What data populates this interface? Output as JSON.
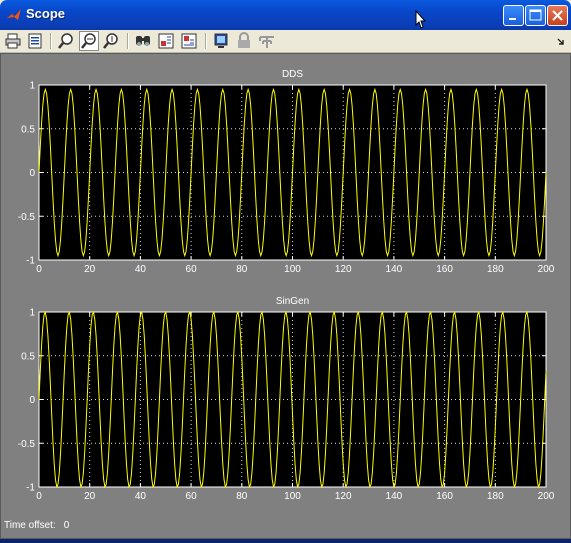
{
  "window": {
    "title": "Scope"
  },
  "toolbar": {
    "items": [
      "print-icon",
      "parameters-icon",
      "zoom-icon",
      "zoom-x-icon",
      "zoom-y-icon",
      "autoscale-icon",
      "save-axes-icon",
      "restore-axes-icon",
      "floating-scope-icon",
      "lock-icon",
      "signal-selection-icon"
    ],
    "active": "zoom-x-icon"
  },
  "status": {
    "label": "Time offset:",
    "value": "0"
  },
  "colors": {
    "trace": "#ffff00",
    "axes_bg": "#000000",
    "figure_bg": "#808080",
    "grid": "#ffffff",
    "text": "#ffffff"
  },
  "chart_data": [
    {
      "type": "line",
      "title": "DDS",
      "xlim": [
        0,
        200
      ],
      "ylim": [
        -1,
        1
      ],
      "xticks": [
        "0",
        "20",
        "40",
        "60",
        "80",
        "100",
        "120",
        "140",
        "160",
        "180",
        "200"
      ],
      "yticks": [
        "1",
        "0.5",
        "0",
        "-0.5",
        "-1"
      ],
      "grid": true,
      "series": [
        {
          "function": "sin",
          "amplitude": 0.95,
          "period": 10,
          "phase": 0,
          "x_start": 0,
          "x_end": 200,
          "step": 0.5
        }
      ]
    },
    {
      "type": "line",
      "title": "SinGen",
      "xlim": [
        0,
        200
      ],
      "ylim": [
        -1,
        1
      ],
      "xticks": [
        "0",
        "20",
        "40",
        "60",
        "80",
        "100",
        "120",
        "140",
        "160",
        "180",
        "200"
      ],
      "yticks": [
        "1",
        "0.5",
        "0",
        "-0.5",
        "-1"
      ],
      "grid": true,
      "series": [
        {
          "function": "sin",
          "amplitude": 1.0,
          "period": 9.5,
          "phase": 0,
          "x_start": 0,
          "x_end": 200,
          "step": 0.5
        }
      ]
    }
  ]
}
